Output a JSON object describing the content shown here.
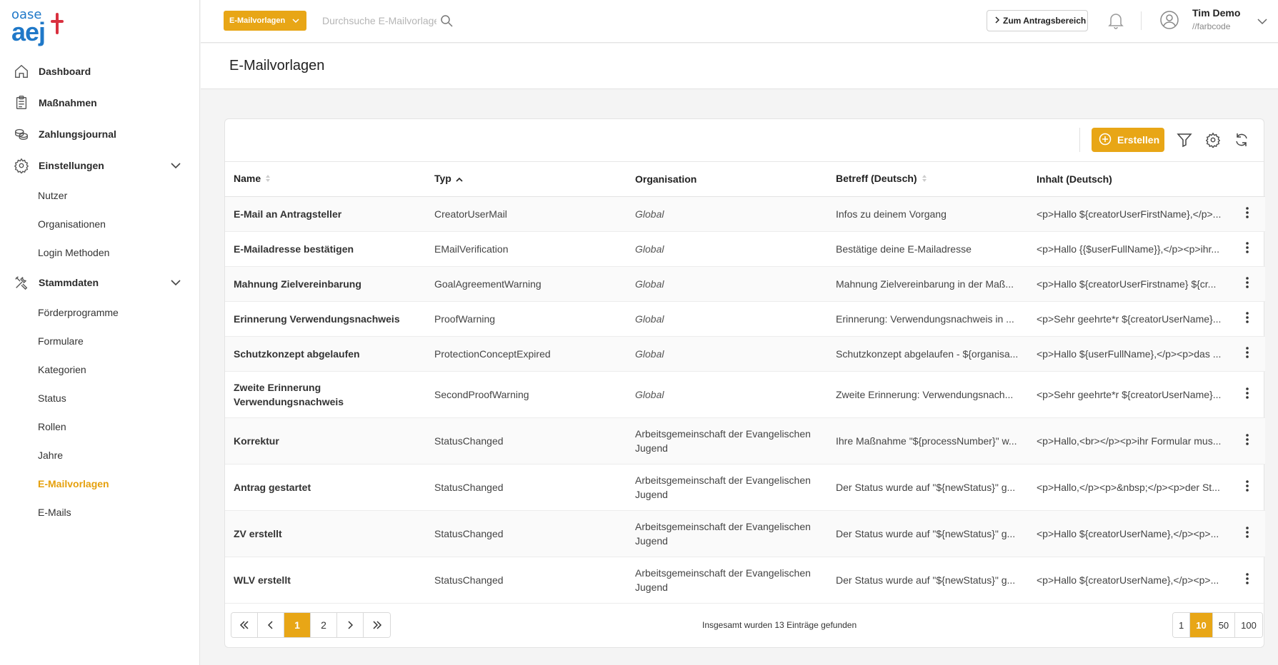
{
  "logo": {
    "line1": "oase",
    "line2": "aej"
  },
  "sidebar": {
    "items": [
      {
        "label": "Dashboard",
        "icon": "home-icon"
      },
      {
        "label": "Maßnahmen",
        "icon": "clipboard-icon"
      },
      {
        "label": "Zahlungsjournal",
        "icon": "coins-icon"
      },
      {
        "label": "Einstellungen",
        "icon": "gear-icon"
      },
      {
        "label": "Stammdaten",
        "icon": "tools-icon"
      }
    ],
    "einstellungen_sub": [
      "Nutzer",
      "Organisationen",
      "Login Methoden"
    ],
    "stammdaten_sub": [
      "Förderprogramme",
      "Formulare",
      "Kategorien",
      "Status",
      "Rollen",
      "Jahre",
      "E-Mailvorlagen",
      "E-Mails"
    ]
  },
  "topbar": {
    "search_type": "E-Mailvorlagen",
    "search_placeholder": "Durchsuche E-Mailvorlagen",
    "antrag_button": "Zum Antragsbereich",
    "user_name": "Tim Demo",
    "user_org": "//farbcode"
  },
  "page": {
    "title": "E-Mailvorlagen"
  },
  "toolbar": {
    "create_label": "Erstellen"
  },
  "table": {
    "columns": [
      "Name",
      "Typ",
      "Organisation",
      "Betreff (Deutsch)",
      "Inhalt (Deutsch)"
    ],
    "rows": [
      [
        "E-Mail an Antragsteller",
        "CreatorUserMail",
        "Global",
        "Infos zu deinem Vorgang",
        "<p>Hallo ${creatorUserFirstName},</p>..."
      ],
      [
        "E-Mailadresse bestätigen",
        "EMailVerification",
        "Global",
        "Bestätige deine E-Mailadresse",
        "<p>Hallo {{$userFullName}},</p><p>ihr..."
      ],
      [
        "Mahnung Zielvereinbarung",
        "GoalAgreementWarning",
        "Global",
        "Mahnung Zielvereinbarung in der Maß...",
        "<p>Hallo ${creatorUserFirstname} ${cr..."
      ],
      [
        "Erinnerung Verwendungsnachweis",
        "ProofWarning",
        "Global",
        "Erinnerung: Verwendungsnachweis in ...",
        "<p>Sehr geehrte*r ${creatorUserName}..."
      ],
      [
        "Schutzkonzept abgelaufen",
        "ProtectionConceptExpired",
        "Global",
        "Schutzkonzept abgelaufen - ${organisa...",
        "<p>Hallo ${userFullName},</p><p>das ..."
      ],
      [
        "Zweite Erinnerung Verwendungsnachweis",
        "SecondProofWarning",
        "Global",
        "Zweite Erinnerung: Verwendungsnach...",
        "<p>Sehr geehrte*r ${creatorUserName}..."
      ],
      [
        "Korrektur",
        "StatusChanged",
        "Arbeitsgemeinschaft der Evangelischen Jugend",
        "Ihre Maßnahme \"${processNumber}\" w...",
        "<p>Hallo,<br></p><p>ihr Formular mus..."
      ],
      [
        "Antrag gestartet",
        "StatusChanged",
        "Arbeitsgemeinschaft der Evangelischen Jugend",
        "Der Status wurde auf \"${newStatus}\" g...",
        "<p>Hallo,</p><p>&nbsp;</p><p>der St..."
      ],
      [
        "ZV erstellt",
        "StatusChanged",
        "Arbeitsgemeinschaft der Evangelischen Jugend",
        "Der Status wurde auf \"${newStatus}\" g...",
        "<p>Hallo ${creatorUserName},</p><p>..."
      ],
      [
        "WLV erstellt",
        "StatusChanged",
        "Arbeitsgemeinschaft der Evangelischen Jugend",
        "Der Status wurde auf \"${newStatus}\" g...",
        "<p>Hallo ${creatorUserName},</p><p>..."
      ]
    ]
  },
  "pagination": {
    "pages": [
      "1",
      "2"
    ],
    "current": "1",
    "total_text": "Insgesamt wurden 13 Einträge gefunden",
    "page_sizes": [
      "1",
      "10",
      "50",
      "100"
    ],
    "current_size": "10"
  },
  "colors": {
    "accent": "#e8a616",
    "brand_blue": "#1f78c8",
    "brand_red": "#d9303f"
  }
}
